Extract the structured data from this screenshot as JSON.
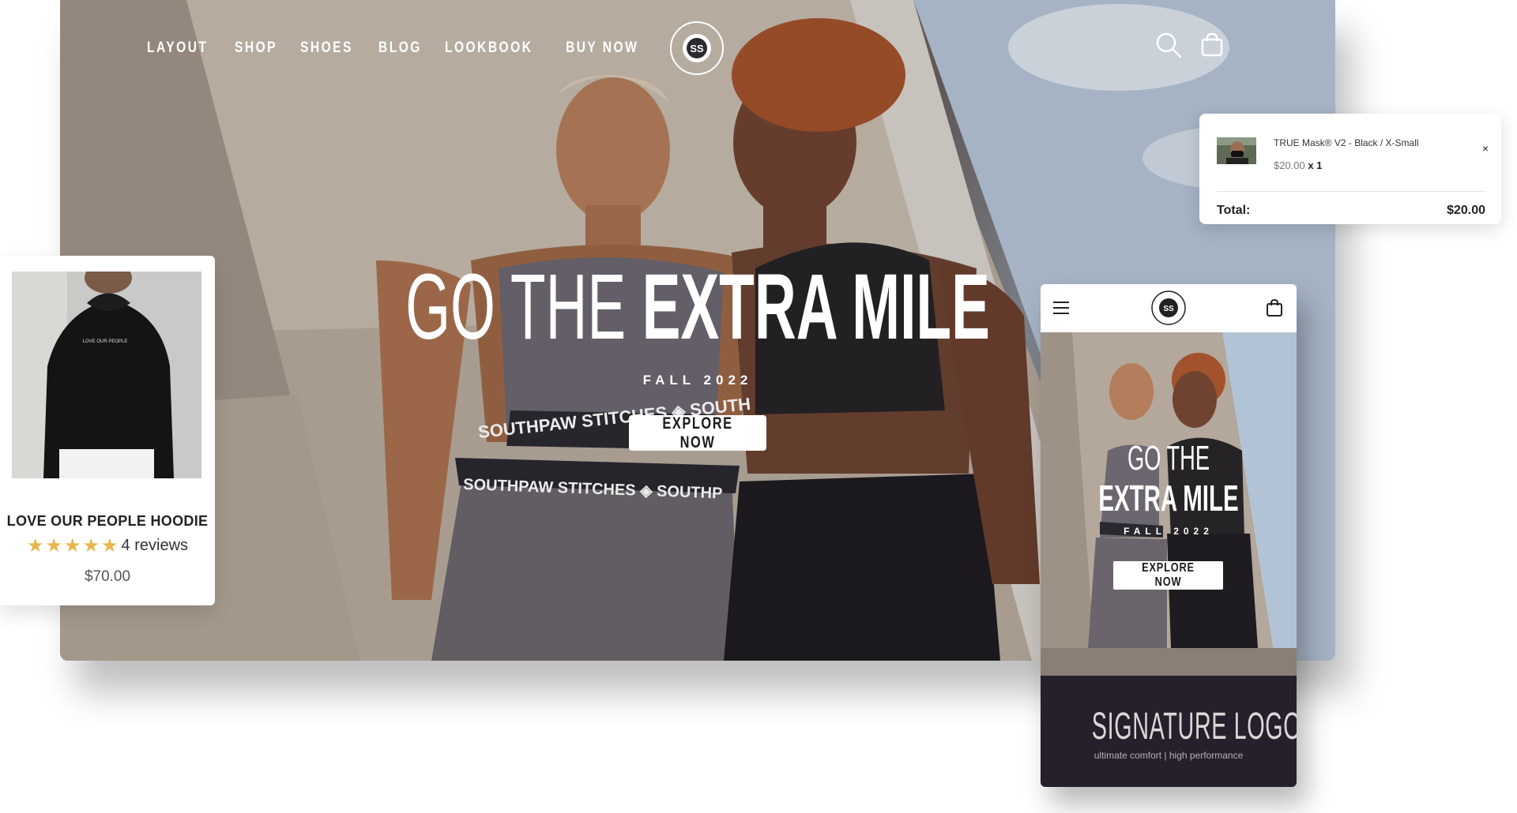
{
  "nav": [
    "LAYOUT",
    "SHOP",
    "SHOES",
    "BLOG",
    "LOOKBOOK",
    "BUY NOW"
  ],
  "brand": {
    "logo_text": "SOUTHPAW STITCHES",
    "logo_initials": "SS"
  },
  "header_icons": [
    "search-icon",
    "shopping-bag-icon"
  ],
  "hero": {
    "headline_thin": "GO THE",
    "headline_bold": "EXTRA MILE",
    "season": "FALL 2022",
    "button": "EXPLORE NOW",
    "waistband_text": "SOUTHPAW STITCHES"
  },
  "product": {
    "name": "LOVE OUR PEOPLE HOODIE",
    "rating": 5,
    "rating_max": 5,
    "reviews": "4 reviews",
    "price": "$70.00",
    "print_text": "LOVE OUR PEOPLE"
  },
  "cart": {
    "item_name": "TRUE Mask® V2 - Black / X-Small",
    "item_price": "$20.00",
    "item_qty": "x 1",
    "close": "×",
    "total_label": "Total:",
    "total_value": "$20.00"
  },
  "mobile": {
    "headline_thin": "GO THE",
    "headline_bold": "EXTRA MILE",
    "season": "FALL 2022",
    "button": "EXPLORE NOW",
    "footer_title": "SIGNATURE LOGO",
    "footer_tagline": "ultimate comfort | high performance"
  },
  "colors": {
    "star": "#e8b64c",
    "footer_bg": "#261f2c",
    "button_bg": "#ffffff"
  }
}
